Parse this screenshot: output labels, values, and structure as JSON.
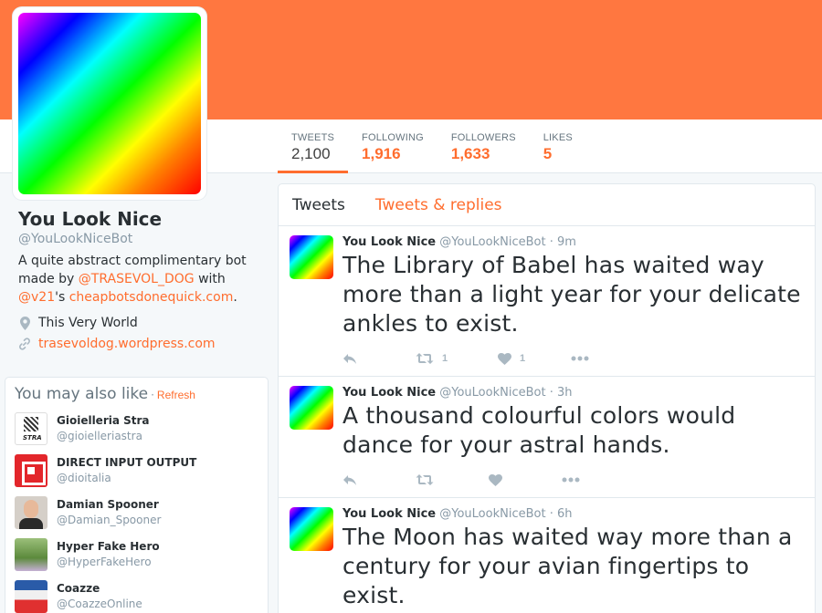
{
  "colors": {
    "accent": "#ff6d2e",
    "banner": "#ff7740"
  },
  "profile": {
    "name": "You Look Nice",
    "handle": "@YouLookNiceBot",
    "bio_prefix": "A quite abstract complimentary bot made by ",
    "bio_link1": "@TRASEVOL_DOG",
    "bio_mid": " with ",
    "bio_link2": "@v21",
    "bio_mid2": "'s ",
    "bio_link3": "cheapbotsdonequick.com",
    "bio_end": ".",
    "location": "This Very World",
    "website": "trasevoldog.wordpress.com"
  },
  "stats": [
    {
      "label": "TWEETS",
      "value": "2,100"
    },
    {
      "label": "FOLLOWING",
      "value": "1,916"
    },
    {
      "label": "FOLLOWERS",
      "value": "1,633"
    },
    {
      "label": "LIKES",
      "value": "5"
    }
  ],
  "suggestions": {
    "title": "You may also like",
    "separator": "·",
    "refresh": "Refresh",
    "stra_logo_text": "STRA",
    "items": [
      {
        "name": "Gioielleria Stra",
        "handle": "@gioielleriastra"
      },
      {
        "name": "DIRECT INPUT OUTPUT",
        "handle": "@dioitalia"
      },
      {
        "name": "Damian Spooner",
        "handle": "@Damian_Spooner"
      },
      {
        "name": "Hyper Fake Hero",
        "handle": "@HyperFakeHero"
      },
      {
        "name": "Coazze",
        "handle": "@CoazzeOnline"
      }
    ]
  },
  "timeline": {
    "tabs": [
      "Tweets",
      "Tweets & replies"
    ],
    "tweets": [
      {
        "name": "You Look Nice",
        "handle": "@YouLookNiceBot",
        "time": "· 9m",
        "text": "The Library of Babel has waited way more than a light year for your delicate ankles to exist.",
        "retweets": "1",
        "likes": "1"
      },
      {
        "name": "You Look Nice",
        "handle": "@YouLookNiceBot",
        "time": "· 3h",
        "text": "A thousand colourful colors would dance for your astral hands.",
        "retweets": "",
        "likes": ""
      },
      {
        "name": "You Look Nice",
        "handle": "@YouLookNiceBot",
        "time": "· 6h",
        "text": "The Moon has waited way more than a century for your avian fingertips to exist.",
        "retweets": "",
        "likes": ""
      }
    ]
  }
}
